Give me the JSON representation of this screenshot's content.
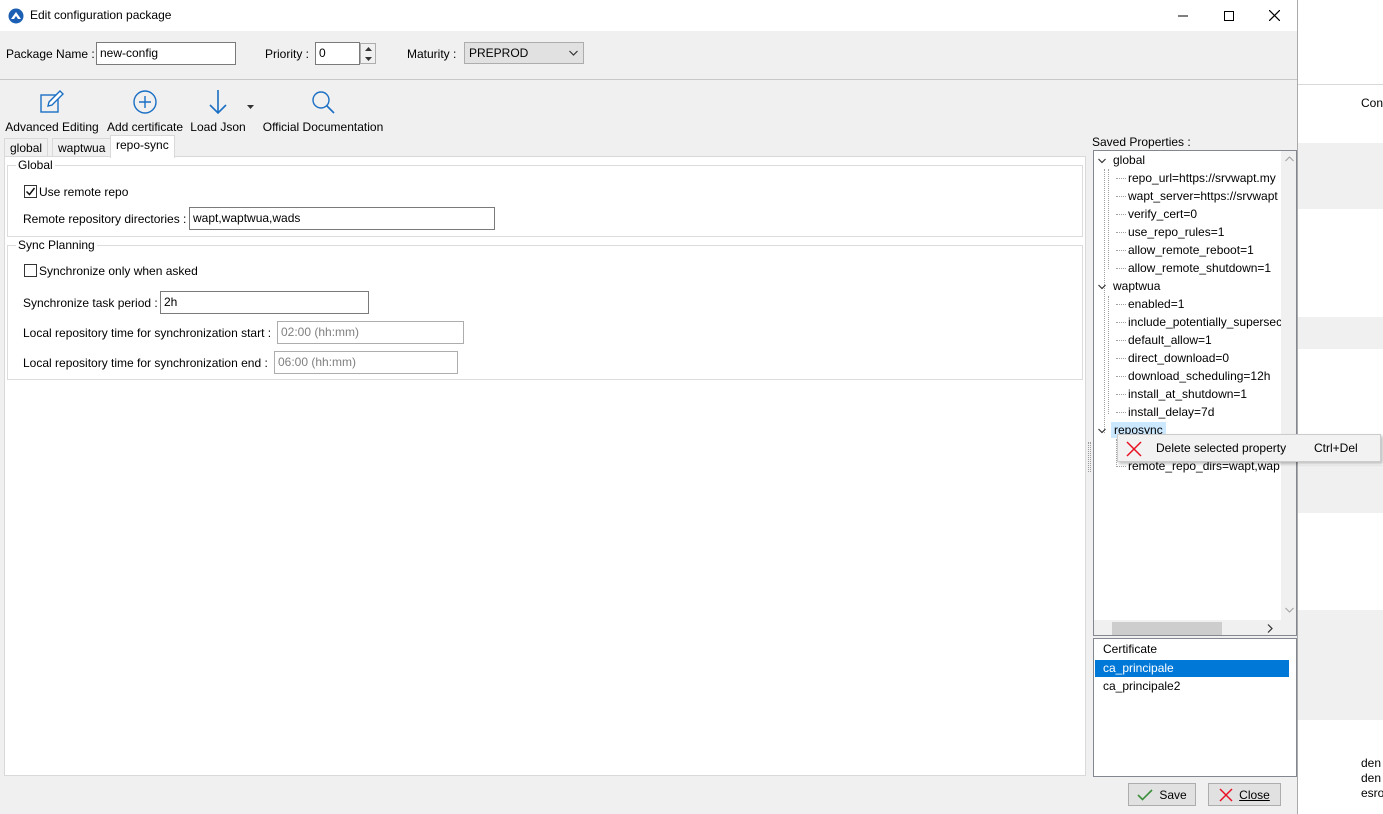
{
  "window": {
    "title": "Edit configuration package",
    "minimize_icon": "minimize-icon",
    "maximize_icon": "maximize-icon",
    "close_icon": "close-icon"
  },
  "package": {
    "name_label": "Package Name :",
    "name_value": "new-config",
    "priority_label": "Priority :",
    "priority_value": "0",
    "maturity_label": "Maturity :",
    "maturity_value": "PREPROD"
  },
  "toolbar": {
    "advanced_editing": "Advanced Editing",
    "add_certificate": "Add certificate",
    "load_json": "Load Json",
    "official_documentation": "Official Documentation"
  },
  "tabs": [
    "global",
    "waptwua",
    "repo-sync"
  ],
  "active_tab": "repo-sync",
  "repo_sync": {
    "global_group": {
      "title": "Global",
      "use_remote_repo_label": "Use remote repo",
      "use_remote_repo_checked": true,
      "remote_dirs_label": "Remote repository directories :",
      "remote_dirs_value": "wapt,waptwua,wads"
    },
    "sync_group": {
      "title": "Sync Planning",
      "sync_only_when_asked_label": "Synchronize only when asked",
      "sync_only_when_asked_checked": false,
      "task_period_label": "Synchronize task period :",
      "task_period_value": "2h",
      "time_start_label": "Local repository time for synchronization start :",
      "time_start_placeholder": "02:00 (hh:mm)",
      "time_end_label": "Local repository time for synchronization end :",
      "time_end_placeholder": "06:00 (hh:mm)"
    }
  },
  "saved_properties": {
    "title": "Saved Properties :",
    "groups": [
      {
        "name": "global",
        "items": [
          "repo_url=https://srvwapt.my",
          "wapt_server=https://srvwapt",
          "verify_cert=0",
          "use_repo_rules=1",
          "allow_remote_reboot=1",
          "allow_remote_shutdown=1"
        ]
      },
      {
        "name": "waptwua",
        "items": [
          "enabled=1",
          "include_potentially_supersec",
          "default_allow=1",
          "direct_download=0",
          "download_scheduling=12h",
          "install_at_shutdown=1",
          "install_delay=7d"
        ]
      },
      {
        "name": "reposync",
        "items": [
          "",
          "remote_repo_dirs=wapt,wap"
        ]
      }
    ]
  },
  "context_menu": {
    "item_label": "Delete selected property",
    "shortcut": "Ctrl+Del",
    "icon": "delete-x-icon"
  },
  "certificates": {
    "header": "Certificate",
    "rows": [
      "ca_principale",
      "ca_principale2"
    ],
    "selected": "ca_principale"
  },
  "buttons": {
    "save": "Save",
    "close": "Close"
  },
  "background_app": {
    "header_text": "Con",
    "footer_lines": [
      "den",
      "den",
      "esro"
    ]
  },
  "colors": {
    "selection": "#0078d7",
    "accent_icon": "#1a6fc4",
    "delete_red": "#e81123",
    "save_check": "#3a8f3a"
  }
}
